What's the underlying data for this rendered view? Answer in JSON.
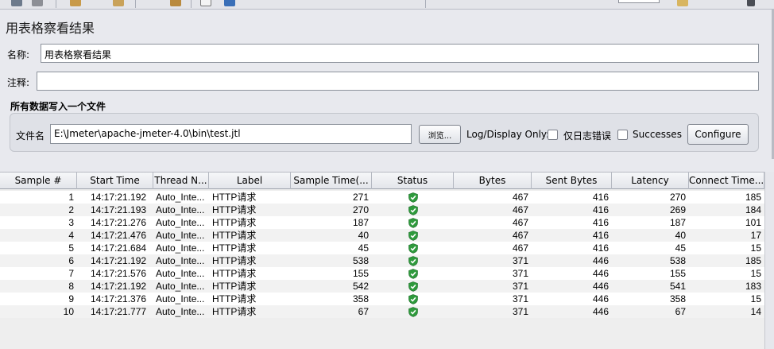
{
  "panel": {
    "title": "用表格察看结果"
  },
  "name_row": {
    "label": "名称:",
    "value": "用表格察看结果"
  },
  "comment_row": {
    "label": "注释:",
    "value": ""
  },
  "file_group": {
    "title": "所有数据写入一个文件",
    "file_label": "文件名",
    "file_value": "E:\\Jmeter\\apache-jmeter-4.0\\bin\\test.jtl",
    "browse_label": "浏览...",
    "log_display_label": "Log/Display Only:",
    "errors_only_label": "仅日志错误",
    "successes_label": "Successes",
    "configure_label": "Configure"
  },
  "table": {
    "headers": [
      "Sample #",
      "Start Time",
      "Thread N...",
      "Label",
      "Sample Time(...",
      "Status",
      "Bytes",
      "Sent Bytes",
      "Latency",
      "Connect Time..."
    ],
    "rows": [
      {
        "sample": "1",
        "start": "14:17:21.192",
        "thread": "Auto_Inte...",
        "label": "HTTP请求",
        "time": "271",
        "status": "success",
        "bytes": "467",
        "sent": "416",
        "latency": "270",
        "connect": "185"
      },
      {
        "sample": "2",
        "start": "14:17:21.193",
        "thread": "Auto_Inte...",
        "label": "HTTP请求",
        "time": "270",
        "status": "success",
        "bytes": "467",
        "sent": "416",
        "latency": "269",
        "connect": "184"
      },
      {
        "sample": "3",
        "start": "14:17:21.276",
        "thread": "Auto_Inte...",
        "label": "HTTP请求",
        "time": "187",
        "status": "success",
        "bytes": "467",
        "sent": "416",
        "latency": "187",
        "connect": "101"
      },
      {
        "sample": "4",
        "start": "14:17:21.476",
        "thread": "Auto_Inte...",
        "label": "HTTP请求",
        "time": "40",
        "status": "success",
        "bytes": "467",
        "sent": "416",
        "latency": "40",
        "connect": "17"
      },
      {
        "sample": "5",
        "start": "14:17:21.684",
        "thread": "Auto_Inte...",
        "label": "HTTP请求",
        "time": "45",
        "status": "success",
        "bytes": "467",
        "sent": "416",
        "latency": "45",
        "connect": "15"
      },
      {
        "sample": "6",
        "start": "14:17:21.192",
        "thread": "Auto_Inte...",
        "label": "HTTP请求",
        "time": "538",
        "status": "success",
        "bytes": "371",
        "sent": "446",
        "latency": "538",
        "connect": "185"
      },
      {
        "sample": "7",
        "start": "14:17:21.576",
        "thread": "Auto_Inte...",
        "label": "HTTP请求",
        "time": "155",
        "status": "success",
        "bytes": "371",
        "sent": "446",
        "latency": "155",
        "connect": "15"
      },
      {
        "sample": "8",
        "start": "14:17:21.192",
        "thread": "Auto_Inte...",
        "label": "HTTP请求",
        "time": "542",
        "status": "success",
        "bytes": "371",
        "sent": "446",
        "latency": "541",
        "connect": "183"
      },
      {
        "sample": "9",
        "start": "14:17:21.376",
        "thread": "Auto_Inte...",
        "label": "HTTP请求",
        "time": "358",
        "status": "success",
        "bytes": "371",
        "sent": "446",
        "latency": "358",
        "connect": "15"
      },
      {
        "sample": "10",
        "start": "14:17:21.777",
        "thread": "Auto_Inte...",
        "label": "HTTP请求",
        "time": "67",
        "status": "success",
        "bytes": "371",
        "sent": "446",
        "latency": "67",
        "connect": "14"
      }
    ]
  },
  "colors": {
    "success_shield": "#2e9a3c"
  },
  "icons": {
    "status_success": "shield-check-icon"
  }
}
